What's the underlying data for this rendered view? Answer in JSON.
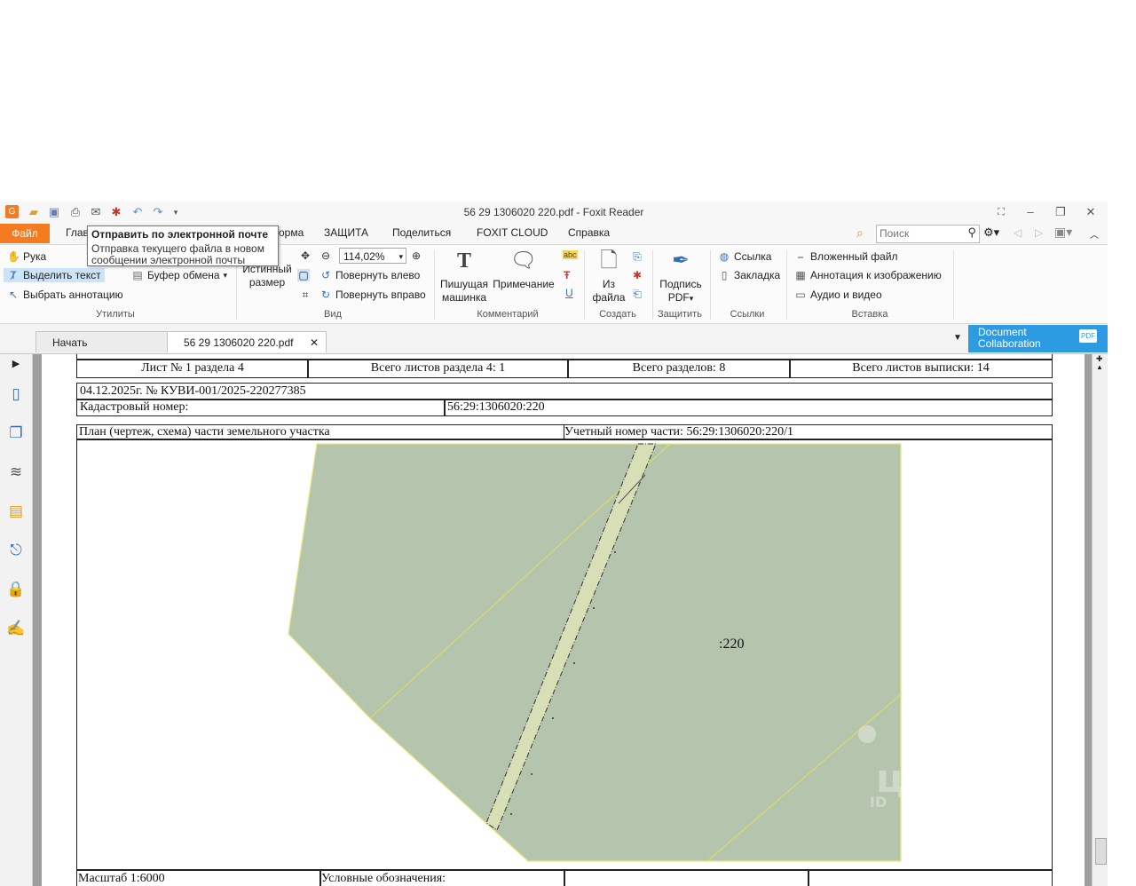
{
  "window": {
    "title": "56 29 1306020 220.pdf - Foxit Reader"
  },
  "menu": {
    "file": "Файл",
    "home_partial": "Глав",
    "form_partial": "орма",
    "items": [
      "ЗАЩИТА",
      "Поделиться",
      "FOXIT CLOUD",
      "Справка"
    ],
    "search_placeholder": "Поиск"
  },
  "tooltip": {
    "title": "Отправить по электронной почте",
    "body_line1": "Отправка текущего файла в новом",
    "body_line2": "сообщении электронной почты"
  },
  "ribbon": {
    "tools": {
      "hand": "Рука",
      "select_text": "Выделить текст",
      "select_annotation": "Выбрать аннотацию",
      "clipboard": "Буфер обмена",
      "group": "Утилиты"
    },
    "view": {
      "actual_size_line1": "Истинный",
      "actual_size_line2": "размер",
      "zoom_value": "114,02%",
      "rotate_left": "Повернуть влево",
      "rotate_right": "Повернуть вправо",
      "group": "Вид"
    },
    "comment": {
      "typewriter_line1": "Пишущая",
      "typewriter_line2": "машинка",
      "note": "Примечание",
      "highlight_icon_text": "abc",
      "group": "Комментарий"
    },
    "create": {
      "from_file_line1": "Из",
      "from_file_line2": "файла",
      "group": "Создать"
    },
    "protect": {
      "sign_line1": "Подпись",
      "sign_line2": "PDF",
      "group": "Защитить"
    },
    "links": {
      "link": "Ссылка",
      "bookmark": "Закладка",
      "group": "Ссылки"
    },
    "insert": {
      "attached_file": "Вложенный файл",
      "image_annotation": "Аннотация к изображению",
      "audio_video": "Аудио и видео",
      "group": "Вставка"
    }
  },
  "tabs": {
    "start": "Начать",
    "document": "56 29 1306020 220.pdf",
    "collab_line1": "Document",
    "collab_line2": "Collaboration",
    "collab_badge": "PDF"
  },
  "pdf": {
    "header_cells": [
      "Лист № 1 раздела 4",
      "Всего листов раздела 4: 1",
      "Всего разделов: 8",
      "Всего листов выписки: 14"
    ],
    "date_line": "04.12.2025г. № КУВИ-001/2025-220277385",
    "cadastral_label": "Кадастровый номер:",
    "cadastral_value": "56:29:1306020:220",
    "plan_label": "План (чертеж, схема) части земельного участка",
    "part_number": "Учетный номер части: 56:29:1306020:220/1",
    "parcel_label": ":220",
    "scale": "Масштаб 1:6000",
    "legend": "Условные обозначения:"
  },
  "watermark": {
    "text": "циан",
    "sub": "ID"
  },
  "colors": {
    "accent_orange": "#f47b20",
    "collab_blue": "#2d9be2",
    "parcel_fill": "#b5c4ad",
    "strip_fill": "#d8dfb6"
  }
}
